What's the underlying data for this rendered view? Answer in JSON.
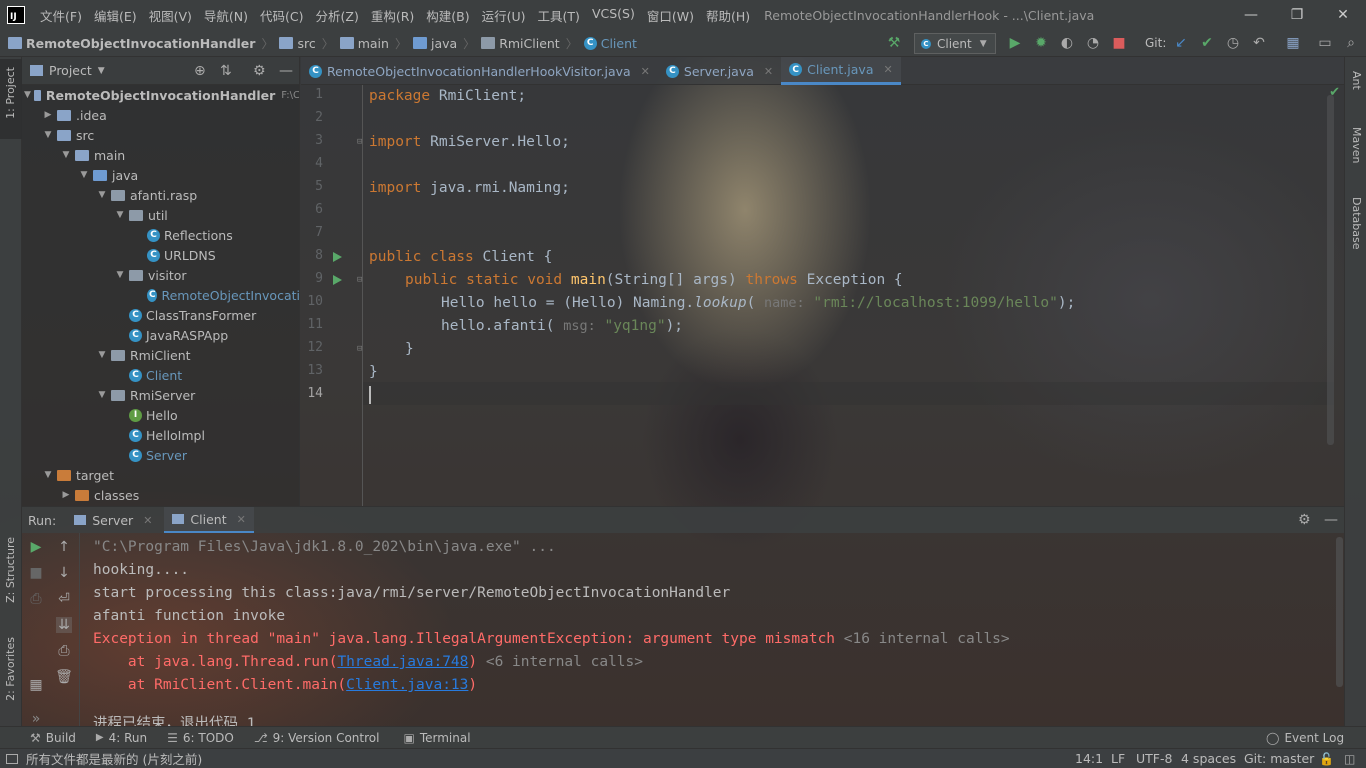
{
  "window": {
    "title": "RemoteObjectInvocationHandlerHook - ...\\Client.java",
    "menu": [
      "文件(F)",
      "编辑(E)",
      "视图(V)",
      "导航(N)",
      "代码(C)",
      "分析(Z)",
      "重构(R)",
      "构建(B)",
      "运行(U)",
      "工具(T)",
      "VCS(S)",
      "窗口(W)",
      "帮助(H)"
    ],
    "controls": {
      "minimize": "—",
      "restore": "❐",
      "close": "✕"
    }
  },
  "navbar": {
    "crumbs": [
      "RemoteObjectInvocationHandler",
      "src",
      "main",
      "java",
      "RmiClient",
      "Client"
    ],
    "run_config": "Client",
    "git_label": "Git:"
  },
  "project_panel": {
    "title": "Project",
    "root": "RemoteObjectInvocationHandler",
    "root_path": "F:\\C",
    "items": [
      {
        "label": ".idea",
        "kind": "folder"
      },
      {
        "label": "src",
        "kind": "folder"
      },
      {
        "label": "main",
        "kind": "folder"
      },
      {
        "label": "java",
        "kind": "src"
      },
      {
        "label": "afanti.rasp",
        "kind": "pkg"
      },
      {
        "label": "util",
        "kind": "pkg"
      },
      {
        "label": "Reflections",
        "kind": "class"
      },
      {
        "label": "URLDNS",
        "kind": "class"
      },
      {
        "label": "visitor",
        "kind": "pkg"
      },
      {
        "label": "RemoteObjectInvocati",
        "kind": "class"
      },
      {
        "label": "ClassTransFormer",
        "kind": "class"
      },
      {
        "label": "JavaRASPApp",
        "kind": "class"
      },
      {
        "label": "RmiClient",
        "kind": "pkg"
      },
      {
        "label": "Client",
        "kind": "class"
      },
      {
        "label": "RmiServer",
        "kind": "pkg"
      },
      {
        "label": "Hello",
        "kind": "interface"
      },
      {
        "label": "HelloImpl",
        "kind": "class"
      },
      {
        "label": "Server",
        "kind": "class"
      },
      {
        "label": "target",
        "kind": "target"
      },
      {
        "label": "classes",
        "kind": "target"
      }
    ]
  },
  "editor": {
    "tabs": [
      {
        "label": "RemoteObjectInvocationHandlerHookVisitor.java",
        "active": false
      },
      {
        "label": "Server.java",
        "active": false
      },
      {
        "label": "Client.java",
        "active": true
      }
    ],
    "line_numbers": [
      "1",
      "2",
      "3",
      "4",
      "5",
      "6",
      "7",
      "8",
      "9",
      "10",
      "11",
      "12",
      "13",
      "14"
    ],
    "code": {
      "l1_kw": "package",
      "l1_rest": " RmiClient;",
      "l3_kw": "import",
      "l3_rest": " RmiServer.Hello;",
      "l5_kw": "import",
      "l5_rest": " java.rmi.Naming;",
      "l8_kw": "public class",
      "l8_rest": " Client {",
      "l9_kw": "public static void",
      "l9_fn": "main",
      "l9_mid": "(String[] args) ",
      "l9_throws": "throws",
      "l9_end": " Exception {",
      "l10_a": "Hello hello = (Hello) Naming.",
      "l10_fn": "lookup",
      "l10_b": "( ",
      "l10_hint": "name:",
      "l10_str": "\"rmi://localhost:1099/hello\"",
      "l10_c": ");",
      "l11_a": "hello.afanti( ",
      "l11_hint": "msg:",
      "l11_str": "\"yq1ng\"",
      "l11_c": ");",
      "l12": "}",
      "l13": "}"
    }
  },
  "left_strip": {
    "project_tab": "1: Project",
    "structure_tab": "Z: Structure",
    "favorites_tab": "2: Favorites"
  },
  "right_strip": {
    "ant_tab": "Ant",
    "maven_tab": "Maven",
    "database_tab": "Database"
  },
  "run_panel": {
    "label": "Run:",
    "tabs": [
      {
        "label": "Server"
      },
      {
        "label": "Client"
      }
    ],
    "lines": {
      "l1": "\"C:\\Program Files\\Java\\jdk1.8.0_202\\bin\\java.exe\" ...",
      "l2": "hooking....",
      "l3": "start processing this class:java/rmi/server/RemoteObjectInvocationHandler",
      "l4": "afanti function invoke",
      "l5_err": "Exception in thread \"main\" java.lang.IllegalArgumentException: argument type mismatch ",
      "l5_gray": "<16 internal calls>",
      "l6_a": "    at java.lang.Thread.run(",
      "l6_link": "Thread.java:748",
      "l6_b": ") ",
      "l6_gray": "<6 internal calls>",
      "l7_a": "    at RmiClient.Client.main(",
      "l7_link": "Client.java:13",
      "l7_b": ")",
      "l8": "进程已结束，退出代码 1"
    }
  },
  "bottom_tabs": {
    "build": "Build",
    "run": "4: Run",
    "todo": "6: TODO",
    "vc": "9: Version Control",
    "terminal": "Terminal",
    "event_log": "Event Log"
  },
  "status": {
    "message": "所有文件都是最新的 (片刻之前)",
    "position": "14:1",
    "line_sep": "LF",
    "encoding": "UTF-8",
    "indent": "4 spaces",
    "git": "Git: master"
  }
}
